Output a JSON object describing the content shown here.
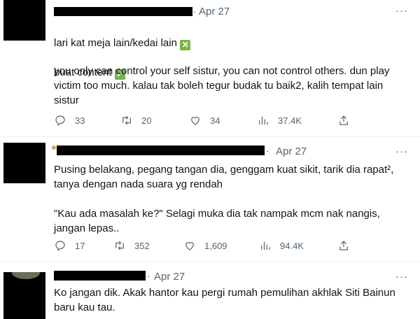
{
  "tweets": [
    {
      "date": "Apr 27",
      "more": "···",
      "line1": "lari kat meja lain/kedai lain",
      "line1_emoji": "✕",
      "line2": "buat content",
      "line2_emoji": "✓",
      "body": "you only can control your self sistur, you can not control others. dun play\nvictim too much. kalau tak boleh tegur budak tu baik2, kalih tempat lain\nsistur",
      "replies": "33",
      "retweets": "20",
      "likes": "34",
      "views": "37.4K"
    },
    {
      "date": "Apr 27",
      "more": "···",
      "body": "Pusing belakang, pegang tangan dia, genggam kuat sikit, tarik dia rapat²,\ntanya dengan nada suara yg rendah\n\n\"Kau ada masalah ke?\" Selagi muka dia tak nampak mcm nak nangis,\njangan lepas..",
      "replies": "17",
      "retweets": "352",
      "likes": "1,609",
      "views": "94.4K"
    },
    {
      "date": "Apr 27",
      "more": "···",
      "body": "Ko jangan dik. Akak hantor kau pergi rumah pemulihan akhlak Siti Bainun\nbaru kau tau."
    }
  ],
  "icons": {
    "reply": "reply-icon",
    "retweet": "retweet-icon",
    "like": "heart-icon",
    "views": "views-icon",
    "share": "share-icon"
  }
}
